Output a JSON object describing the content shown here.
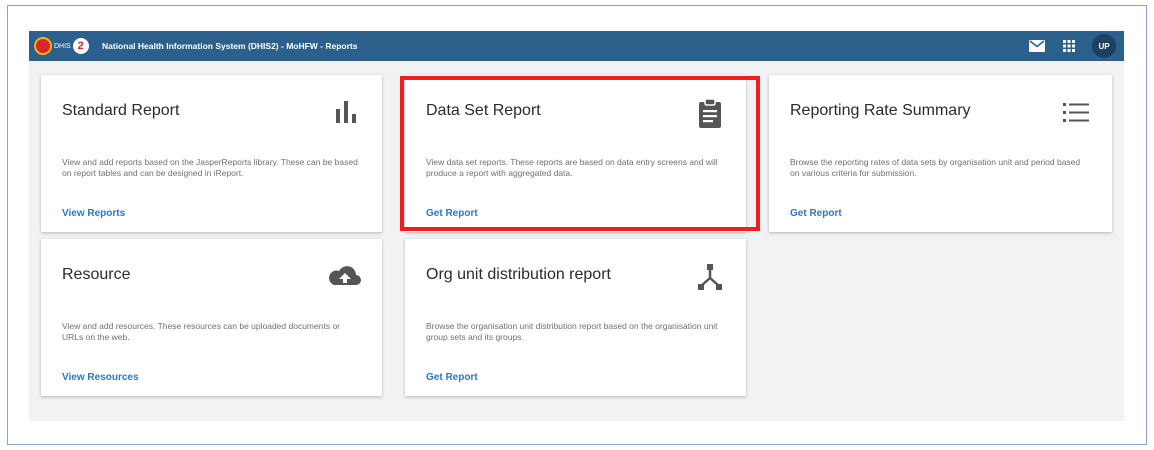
{
  "header": {
    "logo_text": "DHIS",
    "logo_badge": "2",
    "title": "National Health Information System (DHIS2) - MoHFW - Reports",
    "avatar": "UP",
    "icons": [
      "mail-icon",
      "apps-grid-icon"
    ]
  },
  "cards": [
    {
      "title": "Standard Report",
      "description": "View and add reports based on the JasperReports library. These can be based on report tables and can be designed in iReport.",
      "link": "View Reports",
      "icon": "bar-chart-icon"
    },
    {
      "title": "Data Set Report",
      "description": "View data set reports. These reports are based on data entry screens and will produce a report with aggregated data.",
      "link": "Get Report",
      "icon": "clipboard-icon",
      "highlighted": true
    },
    {
      "title": "Reporting Rate Summary",
      "description": "Browse the reporting rates of data sets by organisation unit and period based on various criteria for submission.",
      "link": "Get Report",
      "icon": "list-icon"
    },
    {
      "title": "Resource",
      "description": "View and add resources. These resources can be uploaded documents or URLs on the web.",
      "link": "View Resources",
      "icon": "cloud-upload-icon"
    },
    {
      "title": "Org unit distribution report",
      "description": "Browse the organisation unit distribution report based on the organisation unit group sets and its groups.",
      "link": "Get Report",
      "icon": "hierarchy-icon"
    }
  ],
  "colors": {
    "header_bg": "#2b5f8c",
    "link": "#2c78c5",
    "highlight": "#ef1f1f",
    "icon": "#555555"
  }
}
